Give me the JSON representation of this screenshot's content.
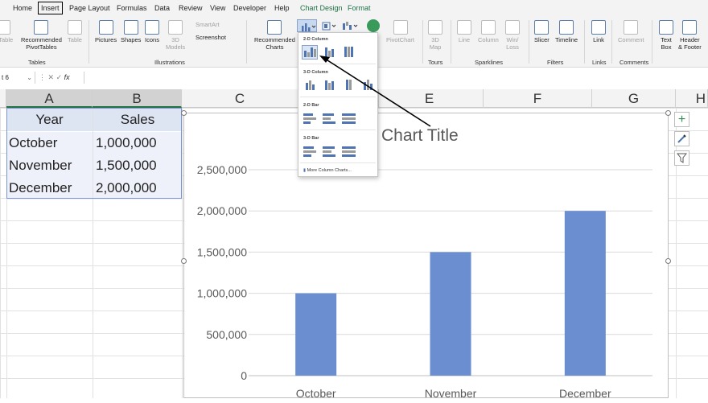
{
  "tabs": [
    "Home",
    "Insert",
    "Page Layout",
    "Formulas",
    "Data",
    "Review",
    "View",
    "Developer",
    "Help",
    "Chart Design",
    "Format"
  ],
  "ribbon": {
    "tables": {
      "pivot": "otTable",
      "recommended": "Recommended\nPivotTables",
      "table": "Table",
      "label": "Tables"
    },
    "illustrations": {
      "pictures": "Pictures",
      "shapes": "Shapes",
      "icons": "Icons",
      "models": "3D\nModels",
      "smartart": "SmartArt",
      "screenshot": "Screenshot",
      "label": "Illustrations"
    },
    "charts": {
      "recommended": "Recommended\nCharts",
      "pivotchart": "PivotChart"
    },
    "tours": {
      "map": "3D\nMap",
      "label": "Tours"
    },
    "sparklines": {
      "line": "Line",
      "column": "Column",
      "winloss": "Win/\nLoss",
      "label": "Sparklines"
    },
    "filters": {
      "slicer": "Slicer",
      "timeline": "Timeline",
      "label": "Filters"
    },
    "links": {
      "link": "Link",
      "label": "Links"
    },
    "comments": {
      "comment": "Comment",
      "label": "Comments"
    },
    "text": {
      "textbox": "Text\nBox",
      "header": "Header\n& Footer"
    }
  },
  "formula_bar": {
    "name_box": "t 6",
    "fx": "fx"
  },
  "columns": [
    "A",
    "B",
    "C",
    "D",
    "E",
    "F",
    "G",
    "H"
  ],
  "cells": {
    "header": [
      "Year",
      "Sales"
    ],
    "rows": [
      [
        "October",
        "1,000,000"
      ],
      [
        "November",
        "1,500,000"
      ],
      [
        "December",
        "2,000,000"
      ]
    ]
  },
  "chart_data": {
    "type": "bar",
    "title": "Chart Title",
    "categories": [
      "October",
      "November",
      "December"
    ],
    "values": [
      1000000,
      1500000,
      2000000
    ],
    "ytick_labels": [
      "0",
      "500,000",
      "1,000,000",
      "1,500,000",
      "2,000,000",
      "2,500,000"
    ],
    "ylim": [
      0,
      2500000
    ],
    "grid": true,
    "bar_color": "#6a8ed0"
  },
  "dropdown": {
    "section_2d_column": "2-D Column",
    "section_3d_column": "3-D Column",
    "section_2d_bar": "2-D Bar",
    "section_3d_bar": "3-D Bar",
    "more": "More Column Charts..."
  },
  "colors": {
    "accent_green": "#1e7145",
    "bar": "#6a8ed0",
    "selection": "#7b93cf"
  }
}
